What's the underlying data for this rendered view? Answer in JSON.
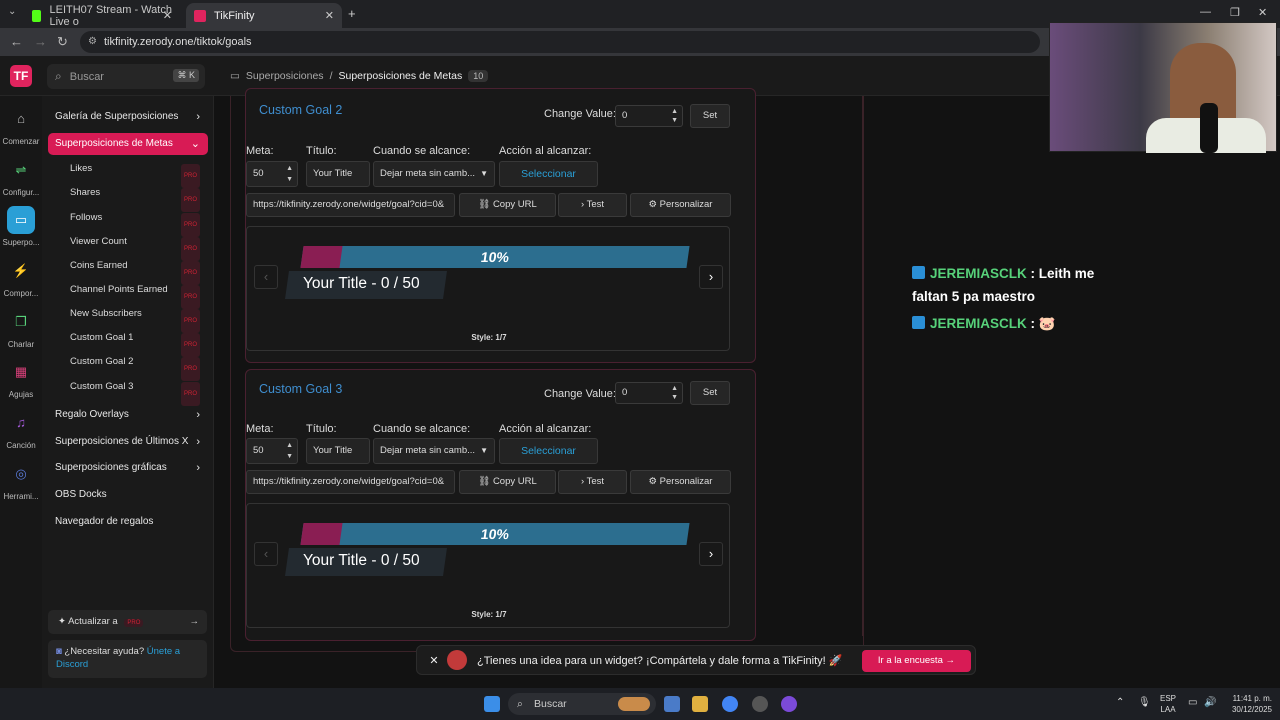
{
  "browser": {
    "tabs": [
      {
        "label": "LEITH07 Stream - Watch Live o",
        "active": false
      },
      {
        "label": "TikFinity",
        "active": true
      }
    ],
    "url": "tikfinity.zerody.one/tiktok/goals"
  },
  "app": {
    "logo": "TF",
    "search_placeholder": "Buscar",
    "search_shortcut": "⌘ K",
    "breadcrumb": {
      "parent": "Superposiciones",
      "separator": "/",
      "current": "Superposiciones de Metas",
      "badge": "10"
    }
  },
  "rail": [
    {
      "label": "Comenzar",
      "icon": "home-icon",
      "glyph": "⌂"
    },
    {
      "label": "Configur...",
      "icon": "settings-icon",
      "glyph": "⇌"
    },
    {
      "label": "Superpo...",
      "icon": "monitor-icon",
      "glyph": "▭"
    },
    {
      "label": "Compor...",
      "icon": "lightning-icon",
      "glyph": "⚡"
    },
    {
      "label": "Charlar",
      "icon": "chat-icon",
      "glyph": "❐"
    },
    {
      "label": "Agujas",
      "icon": "grid-icon",
      "glyph": "▦"
    },
    {
      "label": "Canción",
      "icon": "music-icon",
      "glyph": "♫"
    },
    {
      "label": "Herrami...",
      "icon": "gamepad-icon",
      "glyph": "◎"
    }
  ],
  "sidebar": {
    "top": [
      {
        "label": "Galería de Superposiciones",
        "chevron": "›"
      },
      {
        "label": "Superposiciones de Metas",
        "chevron": "⌄"
      }
    ],
    "sub": [
      "Likes",
      "Shares",
      "Follows",
      "Viewer Count",
      "Coins Earned",
      "Channel Points Earned",
      "New Subscribers",
      "Custom Goal 1",
      "Custom Goal 2",
      "Custom Goal 3"
    ],
    "pro": "PRO",
    "bottom": [
      {
        "label": "Regalo Overlays",
        "chevron": "›"
      },
      {
        "label": "Superposiciones de Últimos X",
        "chevron": "›"
      },
      {
        "label": "Superposiciones gráficas",
        "chevron": "›"
      },
      {
        "label": "OBS Docks",
        "chevron": ""
      },
      {
        "label": "Navegador de regalos",
        "chevron": ""
      }
    ],
    "update": "Actualizar a",
    "help_text": "¿Necesitar ayuda?",
    "help_link": "Únete a Discord"
  },
  "goals": [
    {
      "title": "Custom Goal 2",
      "change_value_label": "Change Value:",
      "change_value": "0",
      "set": "Set",
      "meta_label": "Meta:",
      "titulo_label": "Título:",
      "cuando_label": "Cuando se alcance:",
      "accion_label": "Acción al alcanzar:",
      "meta_value": "50",
      "title_value": "Your Title",
      "cuando_value": "Dejar meta sin camb...",
      "accion_button": "Seleccionar",
      "widget_url": "https://tikfinity.zerody.one/widget/goal?cid=0&",
      "copy_url": "Copy URL",
      "test": "Test",
      "customize": "Personalizar",
      "preview_percent": "10%",
      "preview_fraction": 0.1,
      "preview_title": "Your Title - 0 / 50",
      "style_label": "Style: 1/7"
    },
    {
      "title": "Custom Goal 3",
      "change_value_label": "Change Value:",
      "change_value": "0",
      "set": "Set",
      "meta_label": "Meta:",
      "titulo_label": "Título:",
      "cuando_label": "Cuando se alcance:",
      "accion_label": "Acción al alcanzar:",
      "meta_value": "50",
      "title_value": "Your Title",
      "cuando_value": "Dejar meta sin camb...",
      "accion_button": "Seleccionar",
      "widget_url": "https://tikfinity.zerody.one/widget/goal?cid=0&",
      "copy_url": "Copy URL",
      "test": "Test",
      "customize": "Personalizar",
      "preview_percent": "10%",
      "preview_fraction": 0.1,
      "preview_title": "Your Title - 0 / 50",
      "style_label": "Style: 1/7"
    }
  ],
  "chat": [
    {
      "user": "JEREMIASCLK",
      "sep": ":",
      "text": "Leith me faltan 5 pa maestro"
    },
    {
      "user": "JEREMIASCLK",
      "sep": ":",
      "text": "🐷"
    }
  ],
  "banner": {
    "text": "¿Tienes una idea para un widget? ¡Compártela y dale forma a TikFinity! 🚀",
    "cta": "Ir a la encuesta →"
  },
  "taskbar": {
    "search": "Buscar",
    "lang1": "ESP",
    "lang2": "LAA",
    "time": "11:41 p. m.",
    "date": "30/12/2025"
  },
  "colors": {
    "accent": "#d81b55",
    "link": "#2a9fd6",
    "goal_fill": "#8a1e53",
    "goal_bar": "#2c6e8f",
    "chat_name": "#57d27a"
  }
}
